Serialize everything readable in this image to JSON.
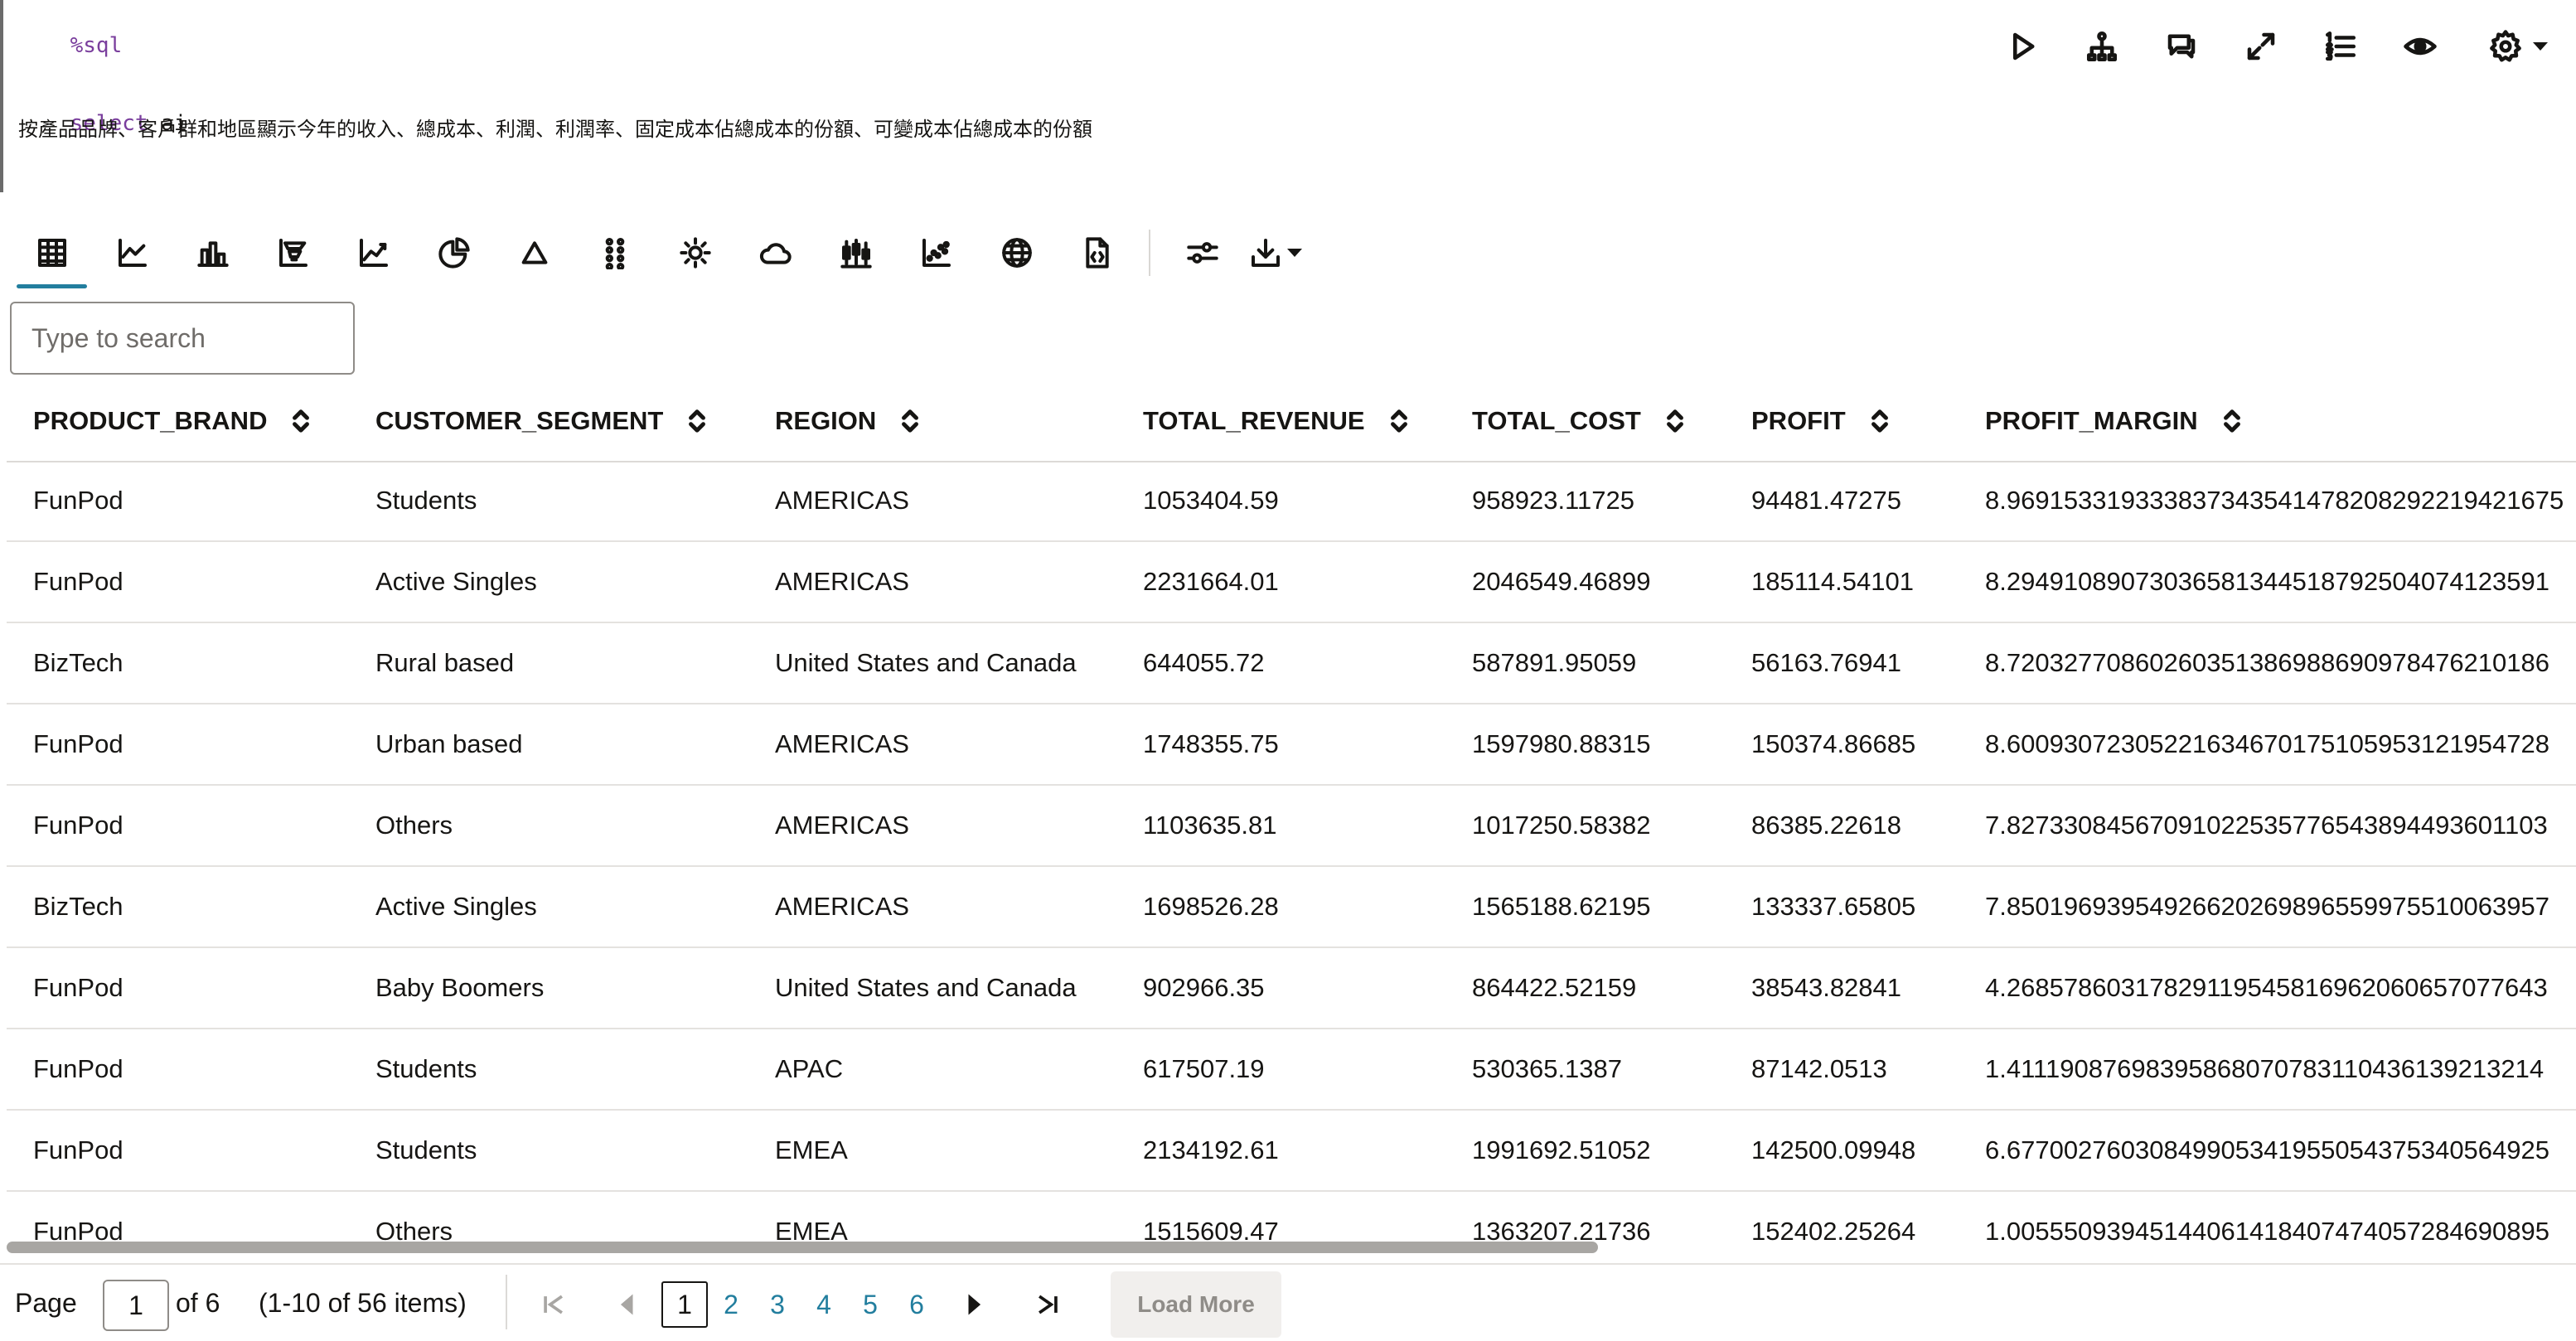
{
  "editor": {
    "magic": "%sql",
    "keyword": "select",
    "keyword_rest": " ai",
    "prompt": "按產品品牌、客戶群和地區顯示今年的收入、總成本、利潤、利潤率、固定成本佔總成本的份額、可變成本佔總成本的份額"
  },
  "top_actions": [
    "run-icon",
    "tree-icon",
    "comment-icon",
    "expand-icon",
    "numbered-list-icon",
    "eye-icon",
    "gear-icon"
  ],
  "viz_toolbar": [
    "table-icon",
    "line-chart-icon",
    "bar-chart-icon",
    "pyramid-chart-icon",
    "area-chart-icon",
    "pie-chart-icon",
    "triangle-icon",
    "dot-grid-icon",
    "sun-icon",
    "cloud-icon",
    "box-plot-icon",
    "scatter-icon",
    "globe-icon",
    "code-file-icon",
    "sliders-icon",
    "download-icon"
  ],
  "search": {
    "placeholder": "Type to search",
    "value": ""
  },
  "table": {
    "columns": [
      "PRODUCT_BRAND",
      "CUSTOMER_SEGMENT",
      "REGION",
      "TOTAL_REVENUE",
      "TOTAL_COST",
      "PROFIT",
      "PROFIT_MARGIN"
    ],
    "rows": [
      [
        "FunPod",
        "Students",
        "AMERICAS",
        "1053404.59",
        "958923.11725",
        "94481.47275",
        "8.969153319333837343541478208292219421675"
      ],
      [
        "FunPod",
        "Active Singles",
        "AMERICAS",
        "2231664.01",
        "2046549.46899",
        "185114.54101",
        "8.29491089073036581344518792504074123591"
      ],
      [
        "BizTech",
        "Rural based",
        "United States and Canada",
        "644055.72",
        "587891.95059",
        "56163.76941",
        "8.72032770860260351386988690978476210186"
      ],
      [
        "FunPod",
        "Urban based",
        "AMERICAS",
        "1748355.75",
        "1597980.88315",
        "150374.86685",
        "8.60093072305221634670175105953121954728"
      ],
      [
        "FunPod",
        "Others",
        "AMERICAS",
        "1103635.81",
        "1017250.58382",
        "86385.22618",
        "7.82733084567091022535776543894493601103"
      ],
      [
        "BizTech",
        "Active Singles",
        "AMERICAS",
        "1698526.28",
        "1565188.62195",
        "133337.65805",
        "7.85019693954926620269896559975510063957"
      ],
      [
        "FunPod",
        "Baby Boomers",
        "United States and Canada",
        "902966.35",
        "864422.52159",
        "38543.82841",
        "4.26857860317829119545816962060657077643"
      ],
      [
        "FunPod",
        "Students",
        "APAC",
        "617507.19",
        "530365.1387",
        "87142.0513",
        "1.41119087698395868070783110436139213214"
      ],
      [
        "FunPod",
        "Students",
        "EMEA",
        "2134192.61",
        "1991692.51052",
        "142500.09948",
        "6.67700276030849905341955054375340564925"
      ],
      [
        "FunPod",
        "Others",
        "EMEA",
        "1515609.47",
        "1363207.21736",
        "152402.25264",
        "1.00555093945144061418407474057284690895"
      ]
    ]
  },
  "pager": {
    "page_label": "Page",
    "current": "1",
    "of_label": "of 6",
    "range_label": "(1-10 of 56 items)",
    "pages": [
      "1",
      "2",
      "3",
      "4",
      "5",
      "6"
    ],
    "load_more": "Load More"
  }
}
